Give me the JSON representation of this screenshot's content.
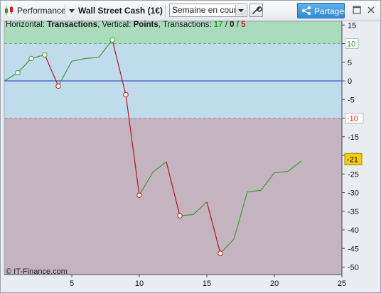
{
  "toolbar": {
    "app_label": "Performance",
    "instrument": "Wall Street Cash (1€)",
    "period": "Semaine en cours",
    "share_label": "Partager",
    "icons": [
      "candlestick-icon",
      "wrench-icon",
      "share-icon",
      "maximize-icon",
      "close-icon"
    ]
  },
  "info": {
    "prefix": "Horizontal: ",
    "horizontal": "Transactions",
    "mid": ", Vertical: ",
    "vertical": "Points",
    "tail": ", Transactions: ",
    "count_total": "17",
    "sep1": " / ",
    "count_neutral": "0",
    "sep2": " / ",
    "count_losing": "5",
    "colors": {
      "total": "#2e9a2e",
      "neutral": "#222222",
      "losing": "#d02020"
    }
  },
  "copyright": "© IT-Finance.com",
  "chart_data": {
    "type": "line",
    "title": "",
    "xlabel": "Transactions",
    "ylabel": "Points",
    "x": [
      0,
      1,
      2,
      3,
      4,
      5,
      6,
      7,
      8,
      9,
      10,
      11,
      12,
      13,
      14,
      15,
      16,
      17,
      18,
      19,
      20,
      21,
      22
    ],
    "y": [
      0,
      2.2,
      6,
      7,
      1.4,
      5.3,
      6,
      6.3,
      11,
      3.7,
      30.7,
      24.5,
      21.7,
      36.2,
      35.9,
      32.5,
      46.3,
      42.5,
      29.8,
      29.4,
      24.7,
      24.3,
      21.5
    ],
    "y_signed": [
      0,
      2.2,
      6,
      7,
      -1.4,
      5.3,
      6,
      6.3,
      11,
      -3.7,
      -30.7,
      -24.5,
      -21.7,
      -36.2,
      -35.9,
      -32.5,
      -46.3,
      -42.5,
      -29.8,
      -29.4,
      -24.7,
      -24.3,
      -21.5
    ],
    "markers": [
      {
        "x": 1,
        "kind": "gain"
      },
      {
        "x": 2,
        "kind": "gain"
      },
      {
        "x": 3,
        "kind": "gain"
      },
      {
        "x": 4,
        "kind": "loss"
      },
      {
        "x": 8,
        "kind": "gain"
      },
      {
        "x": 9,
        "kind": "loss"
      },
      {
        "x": 10,
        "kind": "loss"
      },
      {
        "x": 13,
        "kind": "loss"
      },
      {
        "x": 16,
        "kind": "loss"
      }
    ],
    "xlim": [
      0,
      25
    ],
    "ylim": [
      -52,
      16
    ],
    "x_ticks": [
      5,
      10,
      15,
      20,
      25
    ],
    "y_ticks": [
      15,
      10,
      5,
      0,
      -5,
      -10,
      -15,
      -20,
      -25,
      -30,
      -35,
      -40,
      -45,
      -50
    ],
    "zones": {
      "upper": {
        "from": 10,
        "to": 16,
        "color": "#a8dcbc"
      },
      "middle": {
        "from": -10,
        "to": 10,
        "color": "#c0dcec"
      },
      "lower": {
        "from": -52,
        "to": -10,
        "color": "#c4b4c0"
      }
    },
    "threshold_labels": [
      {
        "value": 10,
        "text": "10",
        "color": "#2e9a2e"
      },
      {
        "value": -10,
        "text": "-10",
        "color": "#d02020"
      }
    ],
    "current_value_label": {
      "value": -21,
      "text": "-21",
      "bg": "#f5d000"
    },
    "colors": {
      "gain": "#3a9a2a",
      "loss": "#b01818",
      "zero_line": "#2030c0"
    },
    "grid": false
  }
}
